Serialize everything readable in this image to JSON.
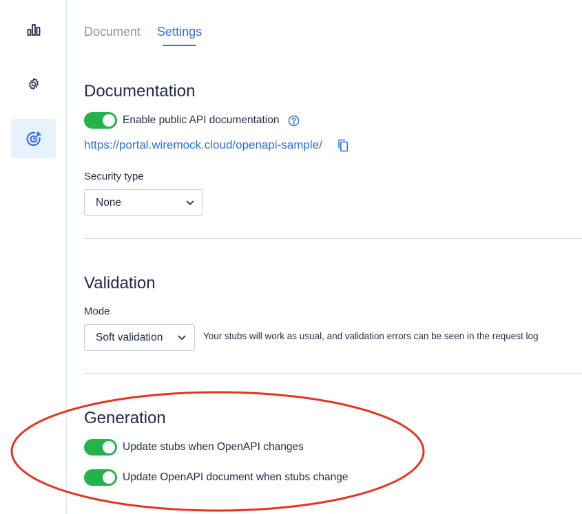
{
  "sidebar": {
    "items": [
      {
        "icon": "bar-chart-icon"
      },
      {
        "icon": "gear-icon"
      },
      {
        "icon": "target-icon",
        "active": true
      }
    ]
  },
  "tabs": [
    {
      "label": "Document",
      "active": false
    },
    {
      "label": "Settings",
      "active": true
    }
  ],
  "documentation": {
    "title": "Documentation",
    "toggle_label": "Enable public API documentation",
    "toggle_on": true,
    "url": "https://portal.wiremock.cloud/openapi-sample/",
    "security_label": "Security type",
    "security_value": "None"
  },
  "validation": {
    "title": "Validation",
    "mode_label": "Mode",
    "mode_value": "Soft validation",
    "mode_hint": "Your stubs will work as usual, and validation errors can be seen in the request log"
  },
  "generation": {
    "title": "Generation",
    "toggles": [
      {
        "label": "Update stubs when OpenAPI changes",
        "on": true
      },
      {
        "label": "Update OpenAPI document when stubs change",
        "on": true
      }
    ]
  },
  "colors": {
    "accent": "#2f6fe0",
    "toggle_on": "#22b34a",
    "annotation": "#e8321f"
  }
}
